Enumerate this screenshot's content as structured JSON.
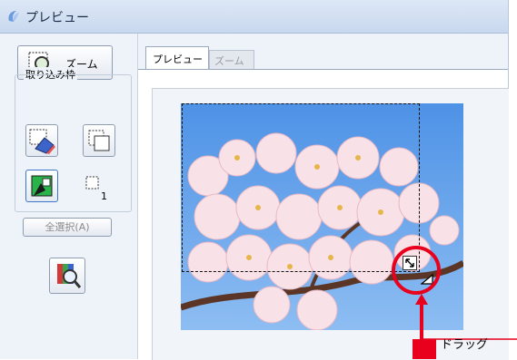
{
  "window": {
    "title": "プレビュー"
  },
  "left_panel": {
    "zoom_button_label": "ズーム",
    "frame_group_label": "取り込み枠",
    "frame_count": "1",
    "select_all_label": "全選択(A)"
  },
  "tabs": [
    {
      "label": "プレビュー",
      "active": true
    },
    {
      "label": "ズーム",
      "active": false
    }
  ],
  "callout": {
    "label": "ドラッグ",
    "color": "#e8001c"
  },
  "colors": {
    "accent_red": "#e8001c",
    "sky": "#6ea8ea",
    "blossom": "#f6dbe2"
  }
}
